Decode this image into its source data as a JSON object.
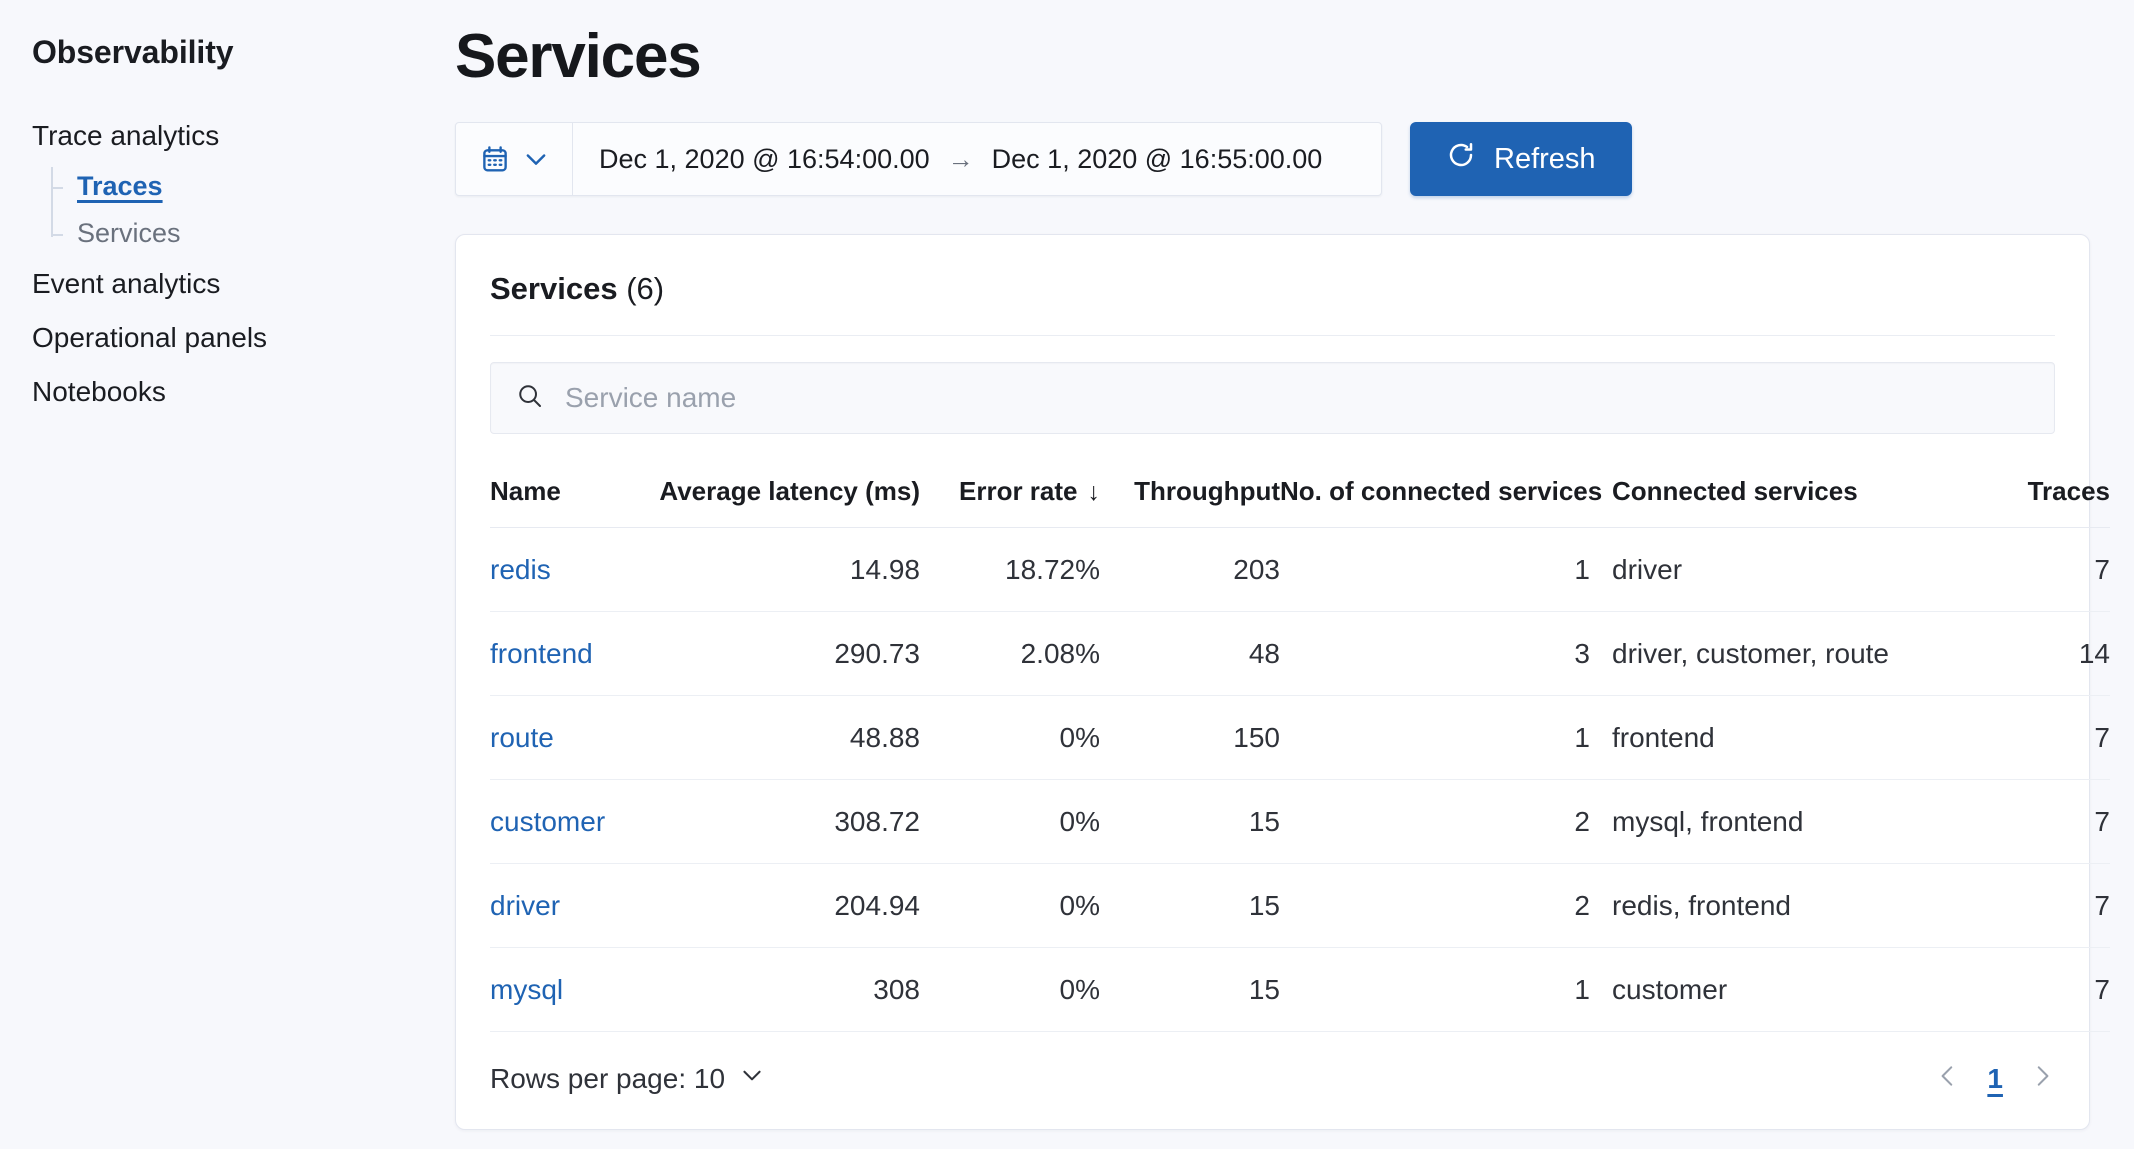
{
  "sidebar": {
    "title": "Observability",
    "items": [
      {
        "label": "Trace analytics",
        "type": "group"
      },
      {
        "label": "Traces",
        "type": "sub",
        "state": "active"
      },
      {
        "label": "Services",
        "type": "sub",
        "state": "muted"
      },
      {
        "label": "Event analytics",
        "type": "group"
      },
      {
        "label": "Operational panels",
        "type": "group"
      },
      {
        "label": "Notebooks",
        "type": "group"
      }
    ]
  },
  "header": {
    "title": "Services"
  },
  "datepicker": {
    "calendar_icon": "calendar-icon",
    "chevron_icon": "chevron-down-icon",
    "start": "Dec 1, 2020 @ 16:54:00.00",
    "separator": "→",
    "end": "Dec 1, 2020 @ 16:55:00.00"
  },
  "refresh": {
    "label": "Refresh",
    "icon": "refresh-icon",
    "color": "#1f63b3"
  },
  "panel": {
    "title": "Services",
    "count": "(6)"
  },
  "search": {
    "placeholder": "Service name",
    "value": "",
    "icon": "search-icon"
  },
  "table": {
    "columns": [
      "Name",
      "Average latency (ms)",
      "Error rate",
      "Throughput",
      "No. of connected services",
      "Connected services",
      "Traces"
    ],
    "sort": {
      "column": "Error rate",
      "direction": "desc",
      "glyph": "↓"
    },
    "rows": [
      {
        "name": "redis",
        "latency": "14.98",
        "error_rate": "18.72%",
        "throughput": "203",
        "num_connected": "1",
        "connected": "driver",
        "traces": "7"
      },
      {
        "name": "frontend",
        "latency": "290.73",
        "error_rate": "2.08%",
        "throughput": "48",
        "num_connected": "3",
        "connected": "driver, customer, route",
        "traces": "14"
      },
      {
        "name": "route",
        "latency": "48.88",
        "error_rate": "0%",
        "throughput": "150",
        "num_connected": "1",
        "connected": "frontend",
        "traces": "7"
      },
      {
        "name": "customer",
        "latency": "308.72",
        "error_rate": "0%",
        "throughput": "15",
        "num_connected": "2",
        "connected": "mysql, frontend",
        "traces": "7"
      },
      {
        "name": "driver",
        "latency": "204.94",
        "error_rate": "0%",
        "throughput": "15",
        "num_connected": "2",
        "connected": "redis, frontend",
        "traces": "7"
      },
      {
        "name": "mysql",
        "latency": "308",
        "error_rate": "0%",
        "throughput": "15",
        "num_connected": "1",
        "connected": "customer",
        "traces": "7"
      }
    ]
  },
  "footer": {
    "rows_per_page_label": "Rows per page: 10",
    "rows_per_page_value": "10",
    "page_current": "1",
    "prev_icon": "chevron-left-icon",
    "next_icon": "chevron-right-icon"
  },
  "colors": {
    "accent": "#1f63b3",
    "link": "#1f63b3",
    "page_bg": "#f7f8fc",
    "panel_bg": "#ffffff",
    "text": "#1a1c21",
    "muted": "#6a717d"
  }
}
